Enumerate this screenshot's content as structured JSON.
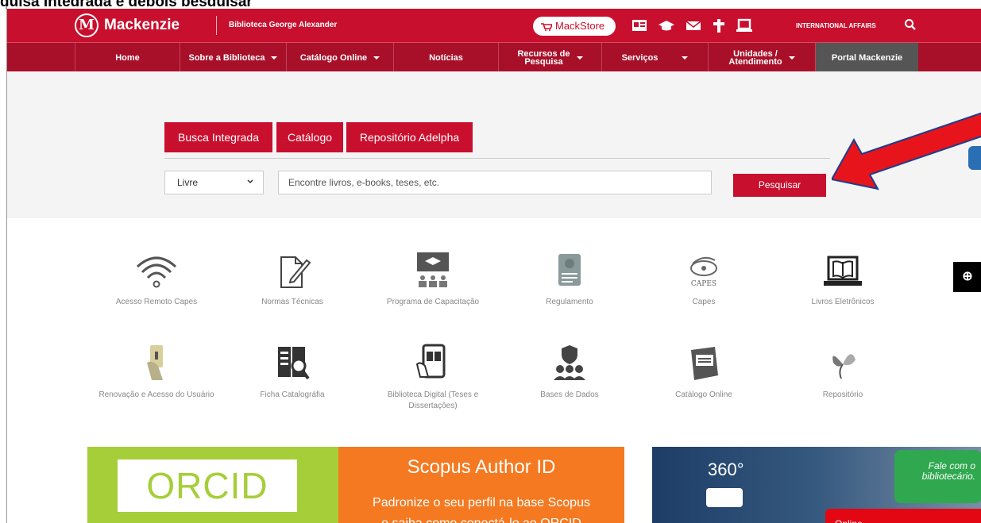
{
  "caption": "quisa Integrada e depois pesquisar",
  "header": {
    "logo_letter": "M",
    "brand": "Mackenzie",
    "subtitle": "Biblioteca George Alexander",
    "mackstore": "MackStore",
    "international": "INTERNATIONAL AFFAIRS"
  },
  "nav": {
    "home": "Home",
    "sobre": "Sobre a Biblioteca",
    "catalogo": "Catálogo Online",
    "noticias": "Notícias",
    "recursos_1": "Recursos de",
    "recursos_2": "Pesquisa",
    "servicos": "Serviços",
    "unidades_1": "Unidades /",
    "unidades_2": "Atendimento",
    "portal": "Portal Mackenzie"
  },
  "search": {
    "tabs": [
      "Busca Integrada",
      "Catálogo",
      "Repositório Adelpha"
    ],
    "selected_filter": "Livre",
    "placeholder": "Encontre livros, e-books, teses, etc.",
    "button": "Pesquisar"
  },
  "services": [
    {
      "label": "Acesso Remoto Capes",
      "icon": "wifi-icon"
    },
    {
      "label": "Normas Técnicas",
      "icon": "document-pen-icon"
    },
    {
      "label": "Programa de Capacitação",
      "icon": "classroom-icon"
    },
    {
      "label": "Regulamento",
      "icon": "certificate-icon"
    },
    {
      "label": "Capes",
      "icon": "capes-logo-icon"
    },
    {
      "label": "Livros Eletrônicos",
      "icon": "laptop-book-icon"
    },
    {
      "label": "Renovação e Acesso do Usuário",
      "icon": "hand-card-icon"
    },
    {
      "label": "Ficha Catalográfia",
      "icon": "catalog-search-icon"
    },
    {
      "label": "Biblioteca Digital (Teses e Dissertações)",
      "icon": "tablet-book-icon"
    },
    {
      "label": "Bases de Dados",
      "icon": "users-shield-icon"
    },
    {
      "label": "Catálogo Online",
      "icon": "book-stack-icon"
    },
    {
      "label": "Repositório",
      "icon": "butterfly-icon"
    }
  ],
  "banners": {
    "orcid": "ORCID",
    "scopus_title": "Scopus Author ID",
    "scopus_line1": "Padronize o seu perfil na base Scopus",
    "scopus_line2": "e saiba como conectá-lo ao ORCID",
    "vr": "360°"
  },
  "chat": {
    "line1": "Fale com o",
    "line2": "bibliotecário.",
    "status": "Online"
  },
  "colors": {
    "brand_red": "#c8102e",
    "nav_red": "#a8102a",
    "orcid_green": "#a6ce39",
    "scopus_orange": "#f47920",
    "chat_green": "#2fa84f"
  }
}
